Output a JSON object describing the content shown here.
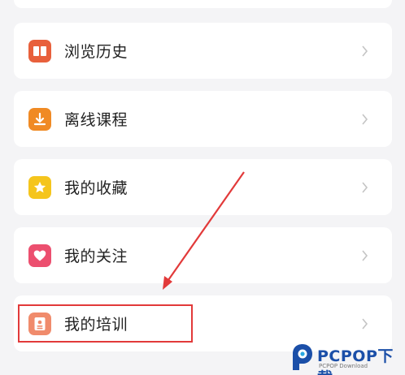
{
  "menu": {
    "items": [
      {
        "label": "浏览历史",
        "icon": "book-icon",
        "color": "#e8603c"
      },
      {
        "label": "离线课程",
        "icon": "download-icon",
        "color": "#f08a24"
      },
      {
        "label": "我的收藏",
        "icon": "star-icon",
        "color": "#f5c51d"
      },
      {
        "label": "我的关注",
        "icon": "heart-icon",
        "color": "#ec4f6f"
      },
      {
        "label": "我的培训",
        "icon": "id-card-icon",
        "color": "#f08b6c"
      }
    ],
    "chevron": "›"
  },
  "annotation": {
    "color": "#e23a3a"
  },
  "watermark": {
    "brand": "PCPOP下载",
    "subtitle": "PCPOP Download"
  }
}
